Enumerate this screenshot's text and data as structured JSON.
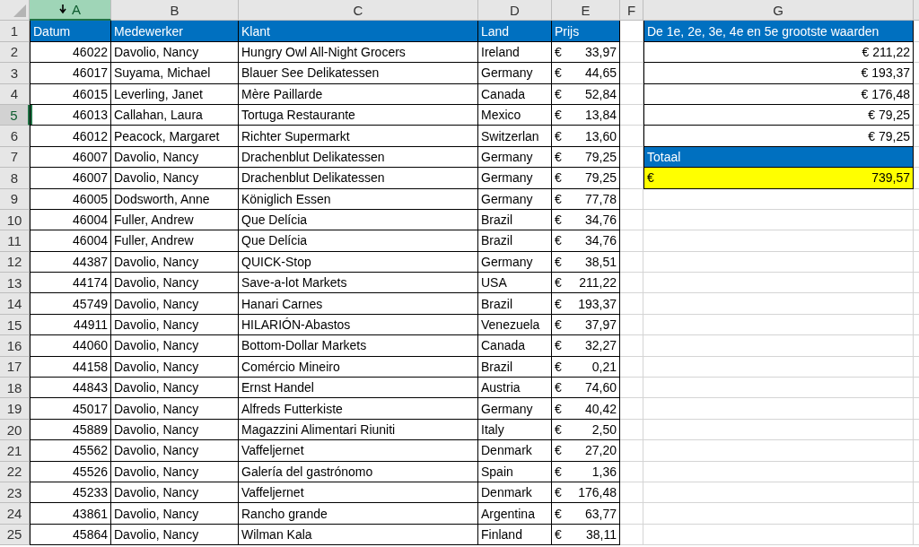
{
  "column_headers": [
    {
      "label": "A",
      "selected": true,
      "filter_arrow": true
    },
    {
      "label": "B",
      "selected": false
    },
    {
      "label": "C",
      "selected": false
    },
    {
      "label": "D",
      "selected": false
    },
    {
      "label": "E",
      "selected": false
    },
    {
      "label": "F",
      "selected": false
    },
    {
      "label": "G",
      "selected": false
    }
  ],
  "row_headers": [
    {
      "label": "1",
      "selected": false
    },
    {
      "label": "2",
      "selected": false
    },
    {
      "label": "3",
      "selected": false
    },
    {
      "label": "4",
      "selected": false
    },
    {
      "label": "5",
      "selected": true
    },
    {
      "label": "6",
      "selected": false
    },
    {
      "label": "7",
      "selected": false
    },
    {
      "label": "8",
      "selected": false
    },
    {
      "label": "9",
      "selected": false
    },
    {
      "label": "10",
      "selected": false
    },
    {
      "label": "11",
      "selected": false
    },
    {
      "label": "12",
      "selected": false
    },
    {
      "label": "13",
      "selected": false
    },
    {
      "label": "14",
      "selected": false
    },
    {
      "label": "15",
      "selected": false
    },
    {
      "label": "16",
      "selected": false
    },
    {
      "label": "17",
      "selected": false
    },
    {
      "label": "18",
      "selected": false
    },
    {
      "label": "19",
      "selected": false
    },
    {
      "label": "20",
      "selected": false
    },
    {
      "label": "21",
      "selected": false
    },
    {
      "label": "22",
      "selected": false
    },
    {
      "label": "23",
      "selected": false
    },
    {
      "label": "24",
      "selected": false
    },
    {
      "label": "25",
      "selected": false
    }
  ],
  "table": {
    "columns": [
      "Datum",
      "Medewerker",
      "Klant",
      "Land",
      "Prijs"
    ],
    "rows": [
      {
        "datum": "46022",
        "medewerker": "Davolio, Nancy",
        "klant": "Hungry Owl All-Night Grocers",
        "land": "Ireland",
        "currency": "€",
        "amount": "33,97"
      },
      {
        "datum": "46017",
        "medewerker": "Suyama, Michael",
        "klant": "Blauer See Delikatessen",
        "land": "Germany",
        "currency": "€",
        "amount": "44,65"
      },
      {
        "datum": "46015",
        "medewerker": "Leverling, Janet",
        "klant": "Mère Paillarde",
        "land": "Canada",
        "currency": "€",
        "amount": "52,84"
      },
      {
        "datum": "46013",
        "medewerker": "Callahan, Laura",
        "klant": "Tortuga Restaurante",
        "land": "Mexico",
        "currency": "€",
        "amount": "13,84"
      },
      {
        "datum": "46012",
        "medewerker": "Peacock, Margaret",
        "klant": "Richter Supermarkt",
        "land": "Switzerlan",
        "currency": "€",
        "amount": "13,60"
      },
      {
        "datum": "46007",
        "medewerker": "Davolio, Nancy",
        "klant": "Drachenblut Delikatessen",
        "land": "Germany",
        "currency": "€",
        "amount": "79,25"
      },
      {
        "datum": "46007",
        "medewerker": "Davolio, Nancy",
        "klant": "Drachenblut Delikatessen",
        "land": "Germany",
        "currency": "€",
        "amount": "79,25"
      },
      {
        "datum": "46005",
        "medewerker": "Dodsworth, Anne",
        "klant": "Königlich Essen",
        "land": "Germany",
        "currency": "€",
        "amount": "77,78"
      },
      {
        "datum": "46004",
        "medewerker": "Fuller, Andrew",
        "klant": "Que Delícia",
        "land": "Brazil",
        "currency": "€",
        "amount": "34,76"
      },
      {
        "datum": "46004",
        "medewerker": "Fuller, Andrew",
        "klant": "Que Delícia",
        "land": "Brazil",
        "currency": "€",
        "amount": "34,76"
      },
      {
        "datum": "44387",
        "medewerker": "Davolio, Nancy",
        "klant": "QUICK-Stop",
        "land": "Germany",
        "currency": "€",
        "amount": "38,51"
      },
      {
        "datum": "44174",
        "medewerker": "Davolio, Nancy",
        "klant": "Save-a-lot Markets",
        "land": "USA",
        "currency": "€",
        "amount": "211,22"
      },
      {
        "datum": "45749",
        "medewerker": "Davolio, Nancy",
        "klant": "Hanari Carnes",
        "land": "Brazil",
        "currency": "€",
        "amount": "193,37"
      },
      {
        "datum": "44911",
        "medewerker": "Davolio, Nancy",
        "klant": "HILARIÓN-Abastos",
        "land": "Venezuela",
        "currency": "€",
        "amount": "37,97"
      },
      {
        "datum": "44060",
        "medewerker": "Davolio, Nancy",
        "klant": "Bottom-Dollar Markets",
        "land": "Canada",
        "currency": "€",
        "amount": "32,27"
      },
      {
        "datum": "44158",
        "medewerker": "Davolio, Nancy",
        "klant": "Comércio Mineiro",
        "land": "Brazil",
        "currency": "€",
        "amount": "0,21"
      },
      {
        "datum": "44843",
        "medewerker": "Davolio, Nancy",
        "klant": "Ernst Handel",
        "land": "Austria",
        "currency": "€",
        "amount": "74,60"
      },
      {
        "datum": "45017",
        "medewerker": "Davolio, Nancy",
        "klant": "Alfreds Futterkiste",
        "land": "Germany",
        "currency": "€",
        "amount": "40,42"
      },
      {
        "datum": "45889",
        "medewerker": "Davolio, Nancy",
        "klant": "Magazzini Alimentari Riuniti",
        "land": "Italy",
        "currency": "€",
        "amount": "2,50"
      },
      {
        "datum": "45562",
        "medewerker": "Davolio, Nancy",
        "klant": "Vaffeljernet",
        "land": "Denmark",
        "currency": "€",
        "amount": "27,20"
      },
      {
        "datum": "45526",
        "medewerker": "Davolio, Nancy",
        "klant": "Galería del gastrónomo",
        "land": "Spain",
        "currency": "€",
        "amount": "1,36"
      },
      {
        "datum": "45233",
        "medewerker": "Davolio, Nancy",
        "klant": "Vaffeljernet",
        "land": "Denmark",
        "currency": "€",
        "amount": "176,48"
      },
      {
        "datum": "43861",
        "medewerker": "Davolio, Nancy",
        "klant": "Rancho grande",
        "land": "Argentina",
        "currency": "€",
        "amount": "63,77"
      },
      {
        "datum": "45864",
        "medewerker": "Davolio, Nancy",
        "klant": "Wilman Kala",
        "land": "Finland",
        "currency": "€",
        "amount": "38,11"
      }
    ]
  },
  "top_values": {
    "heading": "De 1e, 2e, 3e, 4e en 5e grootste waarden",
    "values": [
      "€ 211,22",
      "€ 193,37",
      "€ 176,48",
      "€ 79,25",
      "€ 79,25"
    ],
    "total_label": "Totaal",
    "total_currency": "€",
    "total_amount": "739,57"
  }
}
